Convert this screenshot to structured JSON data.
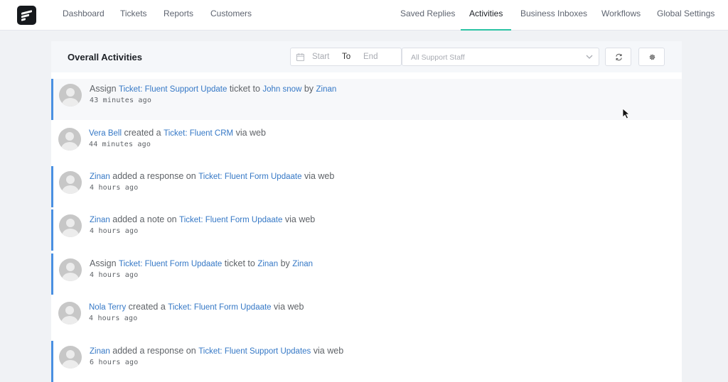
{
  "nav": {
    "left": [
      "Dashboard",
      "Tickets",
      "Reports",
      "Customers"
    ],
    "right": [
      "Saved Replies",
      "Activities",
      "Business Inboxes",
      "Workflows",
      "Global Settings"
    ],
    "active": "Activities",
    "accent_color": "#2bc3a4"
  },
  "header": {
    "title": "Overall Activities",
    "date_start_placeholder": "Start",
    "date_separator": "To",
    "date_end_placeholder": "End",
    "staff_placeholder": "All Support Staff",
    "icons": [
      "calendar-icon",
      "chevron-down-icon",
      "refresh-icon",
      "gear-icon"
    ]
  },
  "activities": [
    {
      "parts": [
        {
          "t": "Assign "
        },
        {
          "t": "Ticket: Fluent Support Update",
          "link": true
        },
        {
          "t": " ticket to "
        },
        {
          "t": "John snow",
          "link": true
        },
        {
          "t": " by "
        },
        {
          "t": "Zinan",
          "link": true
        }
      ],
      "time": "43 minutes ago"
    },
    {
      "parts": [
        {
          "t": "Vera Bell",
          "link": true
        },
        {
          "t": " created a "
        },
        {
          "t": "Ticket: Fluent CRM",
          "link": true
        },
        {
          "t": " via web"
        }
      ],
      "time": "44 minutes ago"
    },
    {
      "parts": [
        {
          "t": "Zinan",
          "link": true
        },
        {
          "t": " added a response on "
        },
        {
          "t": "Ticket: Fluent Form Updaate",
          "link": true
        },
        {
          "t": " via web"
        }
      ],
      "time": "4 hours ago"
    },
    {
      "parts": [
        {
          "t": "Zinan",
          "link": true
        },
        {
          "t": " added a note on "
        },
        {
          "t": "Ticket: Fluent Form Updaate",
          "link": true
        },
        {
          "t": " via web"
        }
      ],
      "time": "4 hours ago"
    },
    {
      "parts": [
        {
          "t": "Assign "
        },
        {
          "t": "Ticket: Fluent Form Updaate",
          "link": true
        },
        {
          "t": " ticket to "
        },
        {
          "t": "Zinan",
          "link": true
        },
        {
          "t": " by "
        },
        {
          "t": "Zinan",
          "link": true
        }
      ],
      "time": "4 hours ago"
    },
    {
      "parts": [
        {
          "t": "Nola Terry",
          "link": true
        },
        {
          "t": " created a "
        },
        {
          "t": "Ticket: Fluent Form Updaate",
          "link": true
        },
        {
          "t": " via web"
        }
      ],
      "time": "4 hours ago"
    },
    {
      "parts": [
        {
          "t": "Zinan",
          "link": true
        },
        {
          "t": " added a response on "
        },
        {
          "t": "Ticket: Fluent Support Updates",
          "link": true
        },
        {
          "t": " via web"
        }
      ],
      "time": "6 hours ago"
    }
  ],
  "colors": {
    "link": "#3578c6",
    "flag_border": "#4a90e2"
  }
}
